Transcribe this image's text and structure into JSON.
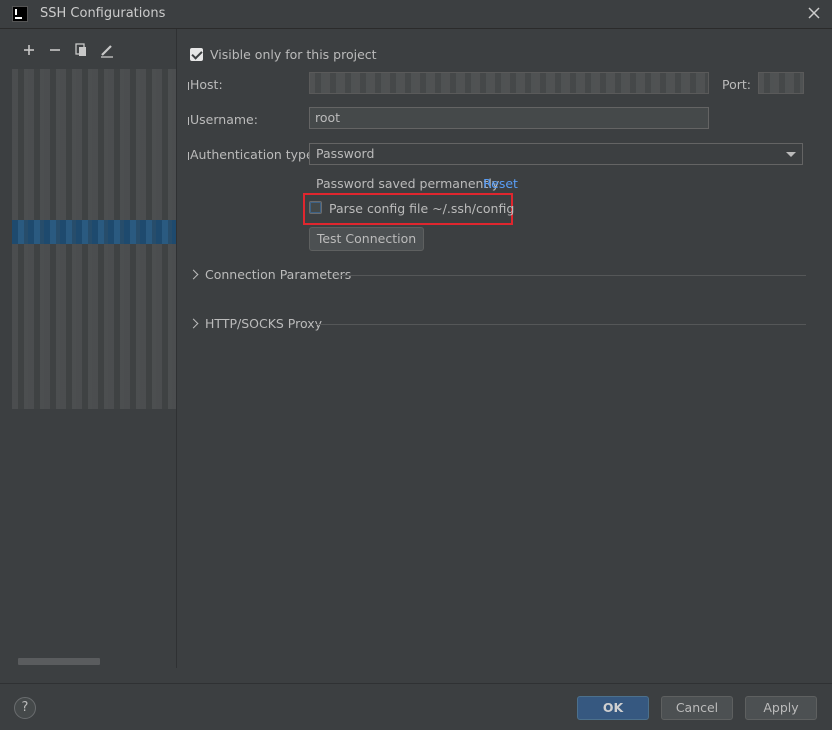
{
  "window": {
    "title": "SSH Configurations"
  },
  "toolbar": {
    "add_icon": "plus-icon",
    "remove_icon": "minus-icon",
    "copy_icon": "copy-icon",
    "edit_icon": "pencil-icon"
  },
  "form": {
    "visible_only_label": "Visible only for this project",
    "visible_only_checked": true,
    "host_label": "Host:",
    "host_value": "",
    "port_label": "Port:",
    "port_value": "",
    "username_label": "Username:",
    "username_value": "root",
    "auth_type_label": "Authentication type:",
    "auth_type_value": "Password",
    "password_saved_text": "Password saved permanently",
    "reset_link": "Reset",
    "parse_config_label": "Parse config file ~/.ssh/config",
    "parse_config_checked": false,
    "test_connection_label": "Test Connection"
  },
  "sections": [
    {
      "label": "Connection Parameters"
    },
    {
      "label": "HTTP/SOCKS Proxy"
    }
  ],
  "footer": {
    "help_label": "?",
    "ok_label": "OK",
    "cancel_label": "Cancel",
    "apply_label": "Apply"
  },
  "colors": {
    "background": "#3c3f41",
    "accent": "#365880",
    "link": "#589df6",
    "highlight": "#e0262e"
  }
}
